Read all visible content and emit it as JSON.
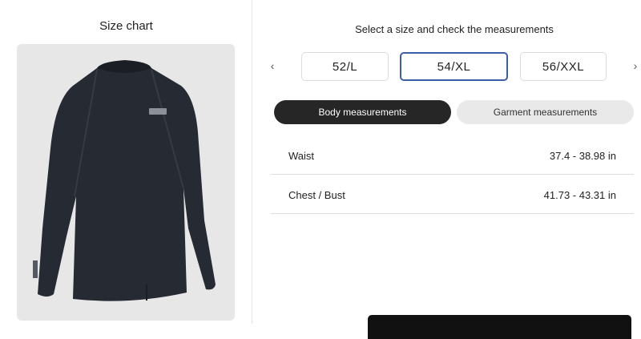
{
  "left_panel": {
    "title": "Size chart",
    "product_image": "dark long-sleeve rash guard top"
  },
  "right_panel": {
    "title": "Select a size and check the measurements",
    "prev_arrow": "‹",
    "next_arrow": "›",
    "sizes": [
      "52/L",
      "54/XL",
      "56/XXL"
    ],
    "selected_size": "54/XL",
    "tabs": {
      "body": "Body measurements",
      "garment": "Garment measurements"
    },
    "active_tab": "body",
    "measurements": [
      {
        "label": "Waist",
        "value": "37.4 - 38.98 in"
      },
      {
        "label": "Chest / Bust",
        "value": "41.73 - 43.31 in"
      }
    ]
  },
  "colors": {
    "selected_border": "#3a5fa8",
    "active_tab_bg": "#262626",
    "inactive_tab_bg": "#e9e9e9"
  }
}
